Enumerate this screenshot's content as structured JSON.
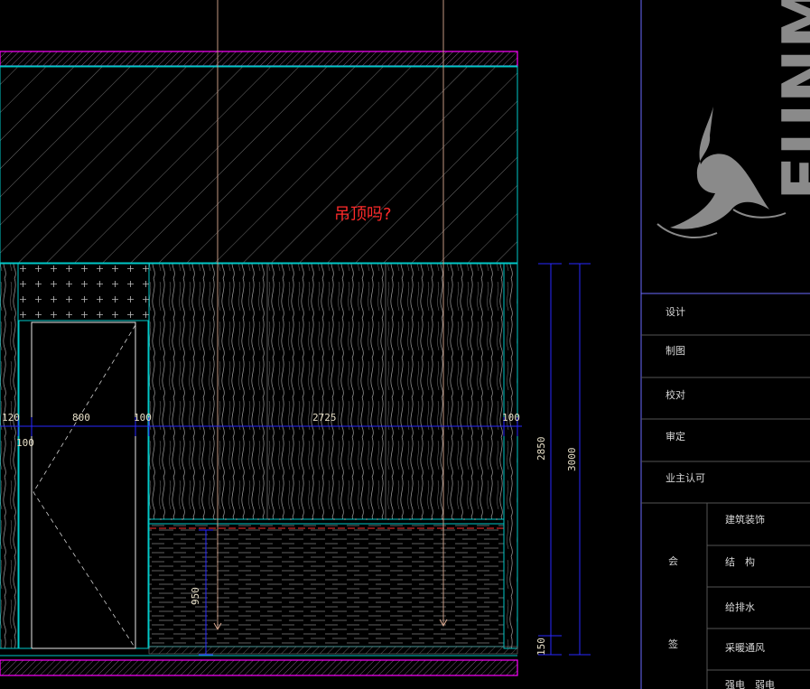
{
  "drawing": {
    "annotation": "吊顶吗?",
    "dimensions": {
      "d120": "120",
      "d800": "800",
      "d100a": "100",
      "d100b": "100",
      "d2725": "2725",
      "d100c": "100",
      "d2850": "2850",
      "d3000": "3000",
      "d950": "950",
      "d150": "150"
    }
  },
  "title_block": {
    "logo_text": "FUNMI",
    "rows": [
      "设计",
      "制图",
      "校对",
      "审定",
      "业主认可"
    ],
    "sign_labels": [
      "会",
      "签"
    ],
    "disciplines": [
      "建筑装饰",
      "结　构",
      "给排水",
      "采暖通风",
      "强电　弱电"
    ]
  },
  "colors": {
    "outline": "#ff00ff",
    "cyan": "#00c8c8",
    "dimension": "#2828ff",
    "hatch": "#9a9a9a",
    "note": "#ff2a2a",
    "axis": "#d8a890"
  }
}
